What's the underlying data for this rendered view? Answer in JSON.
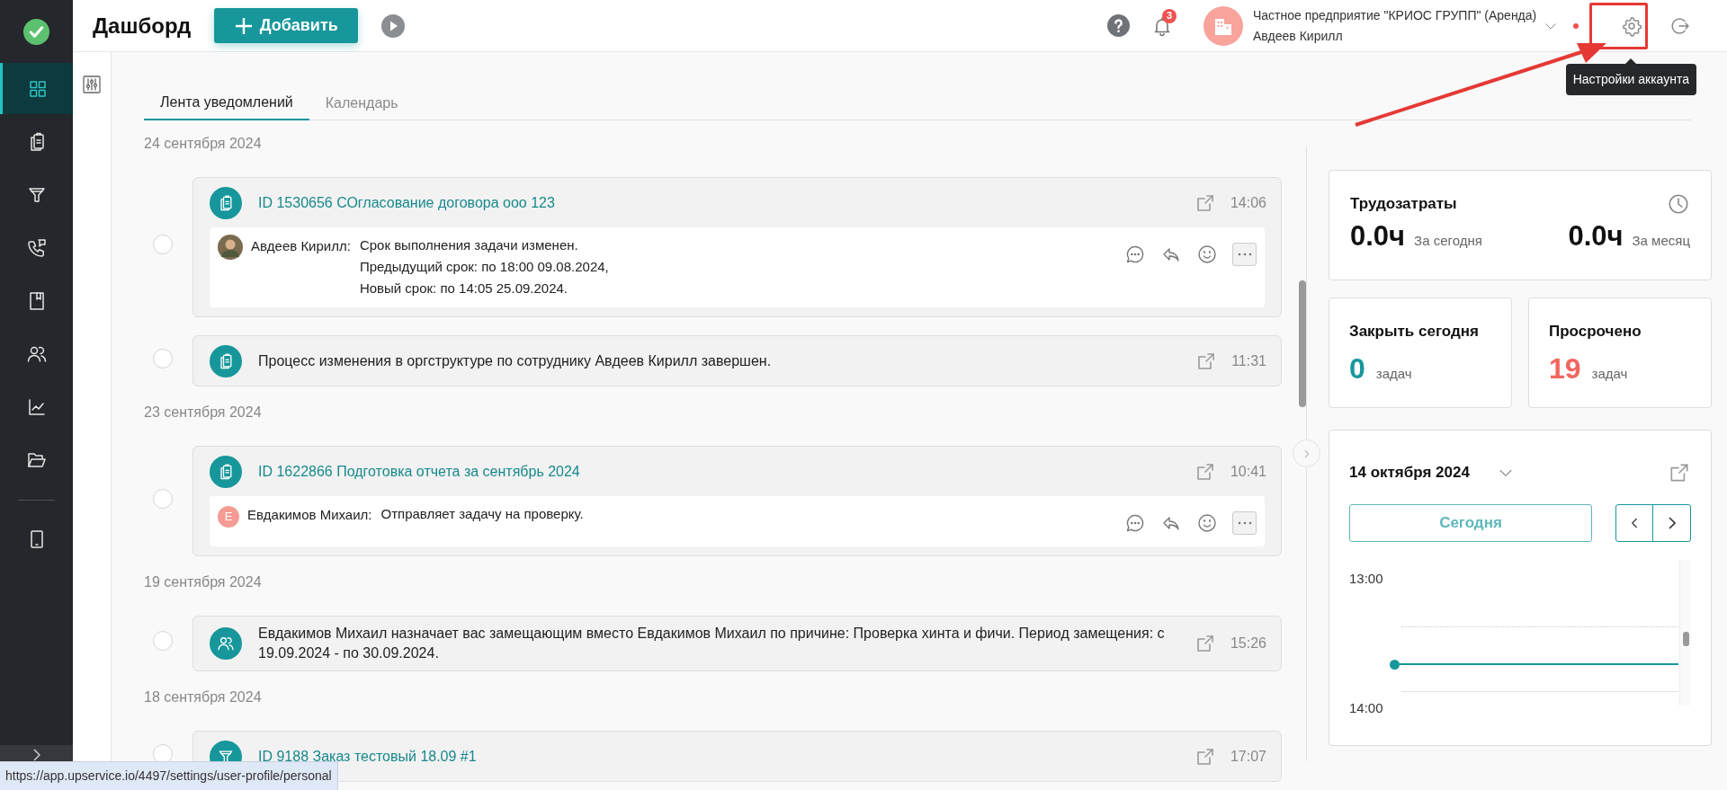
{
  "sidebar": {
    "items": [
      {
        "kind": "dashboard",
        "selected": true
      },
      {
        "kind": "tasks",
        "selected": false
      },
      {
        "kind": "funnel",
        "selected": false
      },
      {
        "kind": "calls",
        "selected": false
      },
      {
        "kind": "book",
        "selected": false
      },
      {
        "kind": "people",
        "selected": false
      },
      {
        "kind": "chart",
        "selected": false
      },
      {
        "kind": "folder",
        "selected": false
      }
    ],
    "extra_items": [
      {
        "kind": "tablet",
        "selected": false
      }
    ]
  },
  "header": {
    "title": "Дашборд",
    "add_button": "Добавить",
    "notification_count": "3",
    "account": {
      "company": "Частное предприятие \"КРИОС ГРУПП\" (Аренда)",
      "user": "Авдеев Кирилл"
    },
    "settings_tooltip": "Настройки аккаунта"
  },
  "tabs": [
    {
      "label": "Лента уведомлений",
      "selected": true
    },
    {
      "label": "Календарь",
      "selected": false
    }
  ],
  "feed": [
    {
      "date": "24 сентября 2024",
      "items": [
        {
          "kind": "tasks",
          "title": "ID 1530656 СОгласование договора ооо 123",
          "link": true,
          "time": "14:06",
          "selected": false,
          "comment": {
            "author": "Авдеев Кирилл:",
            "lines": [
              "Срок выполнения задачи изменен.",
              "Предыдущий срок: по 18:00 09.08.2024,",
              "Новый срок: по 14:05 25.09.2024."
            ]
          }
        },
        {
          "kind": "tasks",
          "title": "Процесс изменения в оргструктуре по сотруднику Авдеев Кирилл завершен.",
          "link": false,
          "time": "11:31",
          "selected": false
        }
      ]
    },
    {
      "date": "23 сентября 2024",
      "items": [
        {
          "kind": "tasks",
          "title": "ID 1622866 Подготовка отчета за сентябрь 2024",
          "link": true,
          "time": "10:41",
          "selected": false,
          "comment": {
            "author": "Евдакимов Михаил:",
            "initial": "Е",
            "lines": [
              "Отправляет задачу на проверку."
            ]
          }
        }
      ]
    },
    {
      "date": "19 сентября 2024",
      "items": [
        {
          "kind": "people",
          "title": "Евдакимов Михаил назначает вас замещающим вместо Евдакимов Михаил по причине: Проверка хинта и фичи. Период замещения: с 19.09.2024 - по 30.09.2024.",
          "link": false,
          "time": "15:26",
          "selected": false
        }
      ]
    },
    {
      "date": "18 сентября 2024",
      "items": [
        {
          "kind": "funnel",
          "title": "ID 9188 Заказ тестовый 18.09 #1",
          "link": true,
          "time": "17:07",
          "selected": false
        }
      ]
    }
  ],
  "labor": {
    "title": "Трудозатраты",
    "today_value": "0.0ч",
    "today_label": "За сегодня",
    "month_value": "0.0ч",
    "month_label": "За месяц"
  },
  "close_today": {
    "title": "Закрыть сегодня",
    "count": "0",
    "unit": "задач"
  },
  "overdue": {
    "title": "Просрочено",
    "count": "19",
    "unit": "задач"
  },
  "calendar": {
    "date": "14 октября 2024",
    "today_button": "Сегодня",
    "hours": [
      "13:00",
      "14:00"
    ]
  },
  "status_bar": {
    "url": "https://app.upservice.io/4497/settings/user-profile/personal"
  }
}
